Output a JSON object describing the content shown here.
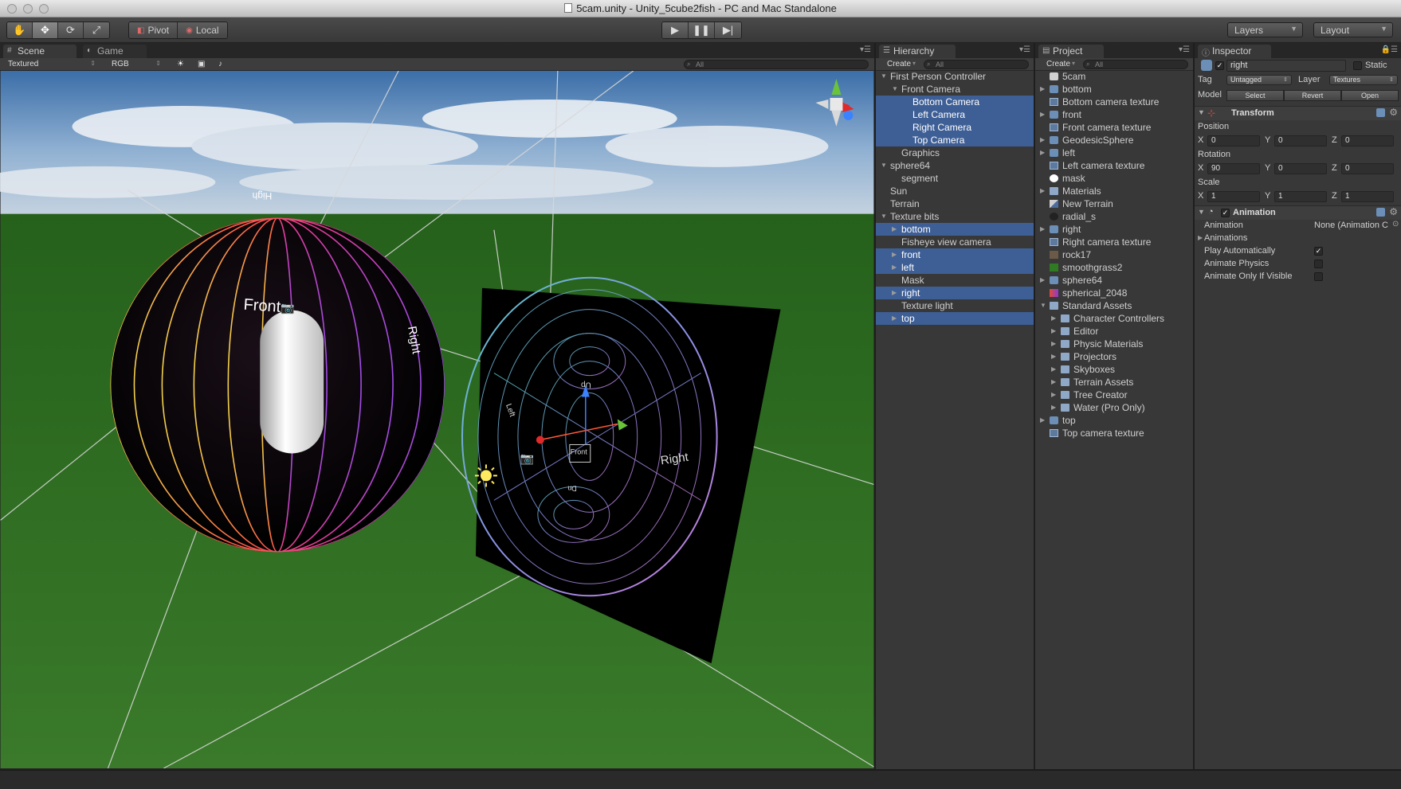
{
  "window": {
    "title": "5cam.unity - Unity_5cube2fish - PC and Mac Standalone"
  },
  "toolbar": {
    "tools": [
      "hand-tool",
      "move-tool",
      "rotate-tool",
      "scale-tool"
    ],
    "pivot_label": "Pivot",
    "local_label": "Local",
    "layers_label": "Layers",
    "layout_label": "Layout"
  },
  "scene": {
    "tab_scene": "Scene",
    "tab_game": "Game",
    "render_mode": "Textured",
    "color_mode": "RGB",
    "search_placeholder": "All",
    "sphere_label_front": "Front",
    "sphere_label_right": "Right",
    "sphere_label_high": "High",
    "fisheye_label_right": "Right",
    "fisheye_label_front": "Front",
    "fisheye_label_left": "Left",
    "fisheye_label_up": "Up",
    "fisheye_label_down": "Dn",
    "colors": {
      "sky_top": "#3b6ea8",
      "sky_bottom": "#c4d2df",
      "grass": "#2d6b1f",
      "selection": "#3e5f96"
    }
  },
  "hierarchy": {
    "tab": "Hierarchy",
    "create_label": "Create",
    "search_placeholder": "All",
    "items": [
      {
        "label": "First Person Controller",
        "level": 0,
        "fold": "open",
        "selected": false
      },
      {
        "label": "Front Camera",
        "level": 1,
        "fold": "open",
        "selected": false
      },
      {
        "label": "Bottom Camera",
        "level": 2,
        "fold": "",
        "selected": true
      },
      {
        "label": "Left Camera",
        "level": 2,
        "fold": "",
        "selected": true
      },
      {
        "label": "Right Camera",
        "level": 2,
        "fold": "",
        "selected": true
      },
      {
        "label": "Top Camera",
        "level": 2,
        "fold": "",
        "selected": true
      },
      {
        "label": "Graphics",
        "level": 1,
        "fold": "",
        "selected": false
      },
      {
        "label": "sphere64",
        "level": 0,
        "fold": "open",
        "selected": false
      },
      {
        "label": "segment",
        "level": 1,
        "fold": "",
        "selected": false
      },
      {
        "label": "Sun",
        "level": 0,
        "fold": "",
        "selected": false
      },
      {
        "label": "Terrain",
        "level": 0,
        "fold": "",
        "selected": false
      },
      {
        "label": "Texture bits",
        "level": 0,
        "fold": "open",
        "selected": false
      },
      {
        "label": "bottom",
        "level": 1,
        "fold": "closed",
        "selected": true
      },
      {
        "label": "Fisheye view camera",
        "level": 1,
        "fold": "",
        "selected": false
      },
      {
        "label": "front",
        "level": 1,
        "fold": "closed",
        "selected": true
      },
      {
        "label": "left",
        "level": 1,
        "fold": "closed",
        "selected": true
      },
      {
        "label": "Mask",
        "level": 1,
        "fold": "",
        "selected": false
      },
      {
        "label": "right",
        "level": 1,
        "fold": "closed",
        "selected": true
      },
      {
        "label": "Texture light",
        "level": 1,
        "fold": "",
        "selected": false
      },
      {
        "label": "top",
        "level": 1,
        "fold": "closed",
        "selected": true
      }
    ]
  },
  "project": {
    "tab": "Project",
    "create_label": "Create",
    "search_placeholder": "All",
    "items": [
      {
        "label": "5cam",
        "level": 0,
        "fold": "",
        "icon": "unity-scene-icon"
      },
      {
        "label": "bottom",
        "level": 0,
        "fold": "closed",
        "icon": "prefab-icon"
      },
      {
        "label": "Bottom camera texture",
        "level": 0,
        "fold": "",
        "icon": "render-texture-icon"
      },
      {
        "label": "front",
        "level": 0,
        "fold": "closed",
        "icon": "prefab-icon"
      },
      {
        "label": "Front camera texture",
        "level": 0,
        "fold": "",
        "icon": "render-texture-icon"
      },
      {
        "label": "GeodesicSphere",
        "level": 0,
        "fold": "closed",
        "icon": "prefab-icon"
      },
      {
        "label": "left",
        "level": 0,
        "fold": "closed",
        "icon": "prefab-icon"
      },
      {
        "label": "Left camera texture",
        "level": 0,
        "fold": "",
        "icon": "render-texture-icon"
      },
      {
        "label": "mask",
        "level": 0,
        "fold": "",
        "icon": "white-circle-icon"
      },
      {
        "label": "Materials",
        "level": 0,
        "fold": "closed",
        "icon": "folder-icon"
      },
      {
        "label": "New Terrain",
        "level": 0,
        "fold": "",
        "icon": "terrain-icon"
      },
      {
        "label": "radial_s",
        "level": 0,
        "fold": "",
        "icon": "dark-texture-icon"
      },
      {
        "label": "right",
        "level": 0,
        "fold": "closed",
        "icon": "prefab-icon"
      },
      {
        "label": "Right camera texture",
        "level": 0,
        "fold": "",
        "icon": "render-texture-icon"
      },
      {
        "label": "rock17",
        "level": 0,
        "fold": "",
        "icon": "rock-texture-icon"
      },
      {
        "label": "smoothgrass2",
        "level": 0,
        "fold": "",
        "icon": "grass-texture-icon"
      },
      {
        "label": "sphere64",
        "level": 0,
        "fold": "closed",
        "icon": "prefab-icon"
      },
      {
        "label": "spherical_2048",
        "level": 0,
        "fold": "",
        "icon": "spherical-texture-icon"
      },
      {
        "label": "Standard Assets",
        "level": 0,
        "fold": "open",
        "icon": "folder-icon"
      },
      {
        "label": "Character Controllers",
        "level": 1,
        "fold": "closed",
        "icon": "folder-icon"
      },
      {
        "label": "Editor",
        "level": 1,
        "fold": "closed",
        "icon": "folder-icon"
      },
      {
        "label": "Physic Materials",
        "level": 1,
        "fold": "closed",
        "icon": "folder-icon"
      },
      {
        "label": "Projectors",
        "level": 1,
        "fold": "closed",
        "icon": "folder-icon"
      },
      {
        "label": "Skyboxes",
        "level": 1,
        "fold": "closed",
        "icon": "folder-icon"
      },
      {
        "label": "Terrain Assets",
        "level": 1,
        "fold": "closed",
        "icon": "folder-icon"
      },
      {
        "label": "Tree Creator",
        "level": 1,
        "fold": "closed",
        "icon": "folder-icon"
      },
      {
        "label": "Water (Pro Only)",
        "level": 1,
        "fold": "closed",
        "icon": "folder-icon"
      },
      {
        "label": "top",
        "level": 0,
        "fold": "closed",
        "icon": "prefab-icon"
      },
      {
        "label": "Top camera texture",
        "level": 0,
        "fold": "",
        "icon": "render-texture-icon"
      }
    ]
  },
  "inspector": {
    "tab": "Inspector",
    "object_name": "right",
    "static_label": "Static",
    "tag_label": "Tag",
    "tag_value": "Untagged",
    "layer_label": "Layer",
    "layer_value": "Textures",
    "model_label": "Model",
    "select_label": "Select",
    "revert_label": "Revert",
    "open_label": "Open",
    "transform": {
      "title": "Transform",
      "position_label": "Position",
      "rotation_label": "Rotation",
      "scale_label": "Scale",
      "x_label": "X",
      "y_label": "Y",
      "z_label": "Z",
      "position": [
        "0",
        "0",
        "0"
      ],
      "rotation": [
        "90",
        "0",
        "0"
      ],
      "scale": [
        "1",
        "1",
        "1"
      ]
    },
    "animation": {
      "title": "Animation",
      "animation_label": "Animation",
      "animation_value": "None (Animation C",
      "animations_label": "Animations",
      "play_auto_label": "Play Automatically",
      "animate_physics_label": "Animate Physics",
      "animate_visible_label": "Animate Only If Visible",
      "play_auto": true,
      "animate_physics": false,
      "animate_visible": false
    }
  }
}
